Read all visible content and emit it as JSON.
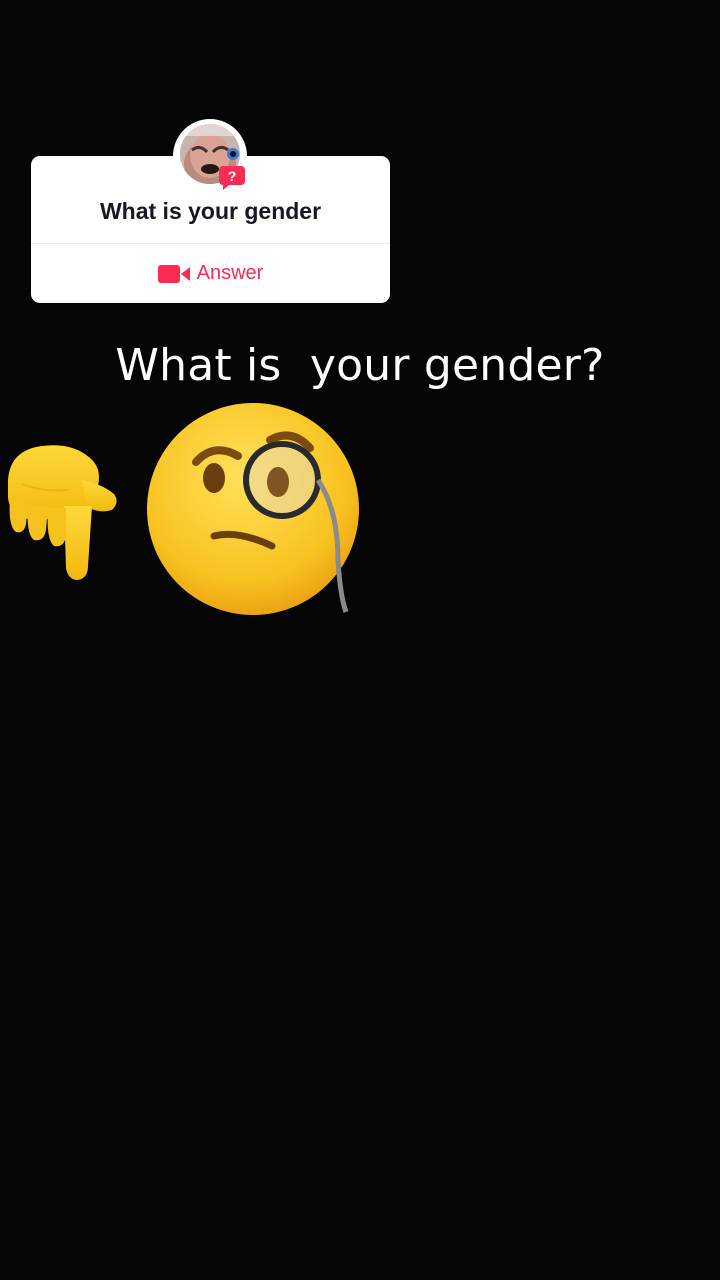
{
  "question_card": {
    "question": "What is your gender",
    "answer_label": "Answer",
    "answer_icon": "video-camera-icon",
    "badge_icon": "question-badge-icon",
    "badge_text": "?"
  },
  "overlay": {
    "caption": "What is  your gender?"
  },
  "stickers": [
    {
      "icon": "backhand-index-pointing-down-emoji"
    },
    {
      "icon": "face-with-monocle-emoji"
    }
  ],
  "colors": {
    "background": "#050505",
    "accent": "#fe2c55",
    "card": "#ffffff",
    "question_text": "#161823",
    "emoji_yellow": "#f7c51f"
  }
}
